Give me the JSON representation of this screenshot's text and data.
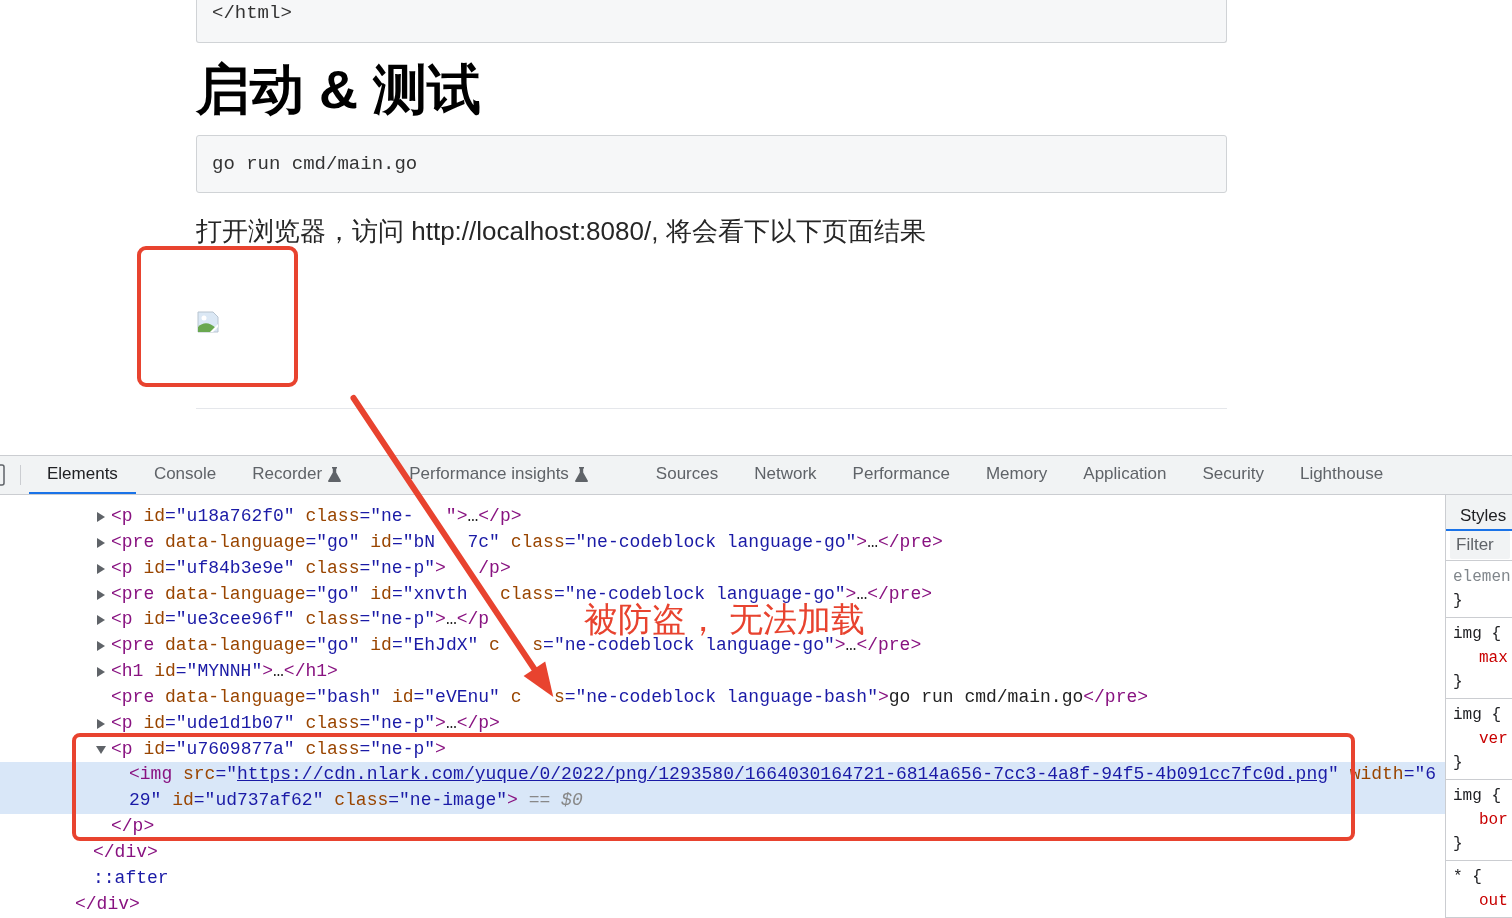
{
  "page": {
    "code_top": "</html>",
    "heading": "启动 & 测试",
    "code_block": "go run cmd/main.go",
    "paragraph": "打开浏览器，访问 http://localhost:8080/, 将会看下以下页面结果"
  },
  "devtools": {
    "tabs": [
      {
        "label": "Elements",
        "selected": true,
        "experimental": false
      },
      {
        "label": "Console",
        "selected": false,
        "experimental": false
      },
      {
        "label": "Recorder",
        "selected": false,
        "experimental": true
      },
      {
        "label": "Performance insights",
        "selected": false,
        "experimental": true
      },
      {
        "label": "Sources",
        "selected": false,
        "experimental": false
      },
      {
        "label": "Network",
        "selected": false,
        "experimental": false
      },
      {
        "label": "Performance",
        "selected": false,
        "experimental": false
      },
      {
        "label": "Memory",
        "selected": false,
        "experimental": false
      },
      {
        "label": "Application",
        "selected": false,
        "experimental": false
      },
      {
        "label": "Security",
        "selected": false,
        "experimental": false
      },
      {
        "label": "Lighthouse",
        "selected": false,
        "experimental": false
      }
    ],
    "tree": [
      {
        "children": [
          {
            "children": [
              {
                "expanded": false,
                "selected": false,
                "segments": [
                  {
                    "kind": "tag",
                    "text": "<p"
                  },
                  {
                    "kind": "attr",
                    "text": " id"
                  },
                  {
                    "kind": "value",
                    "text": "=\"u18a762f0\""
                  },
                  {
                    "kind": "attr",
                    "text": " class"
                  },
                  {
                    "kind": "value",
                    "text": "=\"ne-"
                  },
                  {
                    "kind": "tag",
                    "text": "\">",
                    "hidden_before": true
                  },
                  {
                    "kind": "text",
                    "text": "…"
                  },
                  {
                    "kind": "tag",
                    "text": "</p>"
                  }
                ]
              },
              {
                "expanded": false,
                "selected": false,
                "segments": [
                  {
                    "kind": "tag",
                    "text": "<pre"
                  },
                  {
                    "kind": "attr",
                    "text": " data-language"
                  },
                  {
                    "kind": "value",
                    "text": "=\"go\""
                  },
                  {
                    "kind": "attr",
                    "text": " id"
                  },
                  {
                    "kind": "value",
                    "text": "=\"bN"
                  },
                  {
                    "kind": "value",
                    "text": "7c\"",
                    "hidden_before": true
                  },
                  {
                    "kind": "attr",
                    "text": " class"
                  },
                  {
                    "kind": "value",
                    "text": "=\"ne-codeblock language-go\""
                  },
                  {
                    "kind": "tag",
                    "text": ">"
                  },
                  {
                    "kind": "text",
                    "text": "…"
                  },
                  {
                    "kind": "tag",
                    "text": "</pre>"
                  }
                ]
              },
              {
                "expanded": false,
                "selected": false,
                "segments": [
                  {
                    "kind": "tag",
                    "text": "<p"
                  },
                  {
                    "kind": "attr",
                    "text": " id"
                  },
                  {
                    "kind": "value",
                    "text": "=\"uf84b3e9e\""
                  },
                  {
                    "kind": "attr",
                    "text": " class"
                  },
                  {
                    "kind": "value",
                    "text": "=\"ne-p\""
                  },
                  {
                    "kind": "tag",
                    "text": ">"
                  },
                  {
                    "kind": "tag",
                    "text": "/p>",
                    "hidden_before": true
                  }
                ]
              },
              {
                "expanded": false,
                "selected": false,
                "segments": [
                  {
                    "kind": "tag",
                    "text": "<pre"
                  },
                  {
                    "kind": "attr",
                    "text": " data-language"
                  },
                  {
                    "kind": "value",
                    "text": "=\"go\""
                  },
                  {
                    "kind": "attr",
                    "text": " id"
                  },
                  {
                    "kind": "value",
                    "text": "=\"xnvth"
                  },
                  {
                    "kind": "attr",
                    "text": "class",
                    "hidden_before": true
                  },
                  {
                    "kind": "value",
                    "text": "=\"ne-codeblock language-go\""
                  },
                  {
                    "kind": "tag",
                    "text": ">"
                  },
                  {
                    "kind": "text",
                    "text": "…"
                  },
                  {
                    "kind": "tag",
                    "text": "</pre>"
                  }
                ]
              },
              {
                "expanded": false,
                "selected": false,
                "segments": [
                  {
                    "kind": "tag",
                    "text": "<p"
                  },
                  {
                    "kind": "attr",
                    "text": " id"
                  },
                  {
                    "kind": "value",
                    "text": "=\"ue3cee96f\""
                  },
                  {
                    "kind": "attr",
                    "text": " class"
                  },
                  {
                    "kind": "value",
                    "text": "=\"ne-p\""
                  },
                  {
                    "kind": "tag",
                    "text": ">"
                  },
                  {
                    "kind": "text",
                    "text": "…"
                  },
                  {
                    "kind": "tag",
                    "text": "</p"
                  }
                ]
              },
              {
                "expanded": false,
                "selected": false,
                "segments": [
                  {
                    "kind": "tag",
                    "text": "<pre"
                  },
                  {
                    "kind": "attr",
                    "text": " data-language"
                  },
                  {
                    "kind": "value",
                    "text": "=\"go\""
                  },
                  {
                    "kind": "attr",
                    "text": " id"
                  },
                  {
                    "kind": "value",
                    "text": "=\"EhJdX\""
                  },
                  {
                    "kind": "attr",
                    "text": " c"
                  },
                  {
                    "kind": "attr",
                    "text": "s",
                    "hidden_before": true
                  },
                  {
                    "kind": "value",
                    "text": "=\"ne-codeblock language-go\""
                  },
                  {
                    "kind": "tag",
                    "text": ">"
                  },
                  {
                    "kind": "text",
                    "text": "…"
                  },
                  {
                    "kind": "tag",
                    "text": "</pre>"
                  }
                ]
              },
              {
                "expanded": false,
                "selected": false,
                "segments": [
                  {
                    "kind": "tag",
                    "text": "<h1"
                  },
                  {
                    "kind": "attr",
                    "text": " id"
                  },
                  {
                    "kind": "value",
                    "text": "=\"MYNNH\""
                  },
                  {
                    "kind": "tag",
                    "text": ">"
                  },
                  {
                    "kind": "text",
                    "text": "…"
                  },
                  {
                    "kind": "tag",
                    "text": "</h1>"
                  }
                ]
              },
              {
                "selected": false,
                "segments": [
                  {
                    "kind": "tag",
                    "text": "<pre"
                  },
                  {
                    "kind": "attr",
                    "text": " data-language"
                  },
                  {
                    "kind": "value",
                    "text": "=\"bash\""
                  },
                  {
                    "kind": "attr",
                    "text": " id"
                  },
                  {
                    "kind": "value",
                    "text": "=\"eVEnu\""
                  },
                  {
                    "kind": "attr",
                    "text": " c"
                  },
                  {
                    "kind": "attr",
                    "text": "s",
                    "hidden_before": true
                  },
                  {
                    "kind": "value",
                    "text": "=\"ne-codeblock language-bash\""
                  },
                  {
                    "kind": "tag",
                    "text": ">"
                  },
                  {
                    "kind": "text",
                    "text": "go run cmd/main.go"
                  },
                  {
                    "kind": "tag",
                    "text": "</pre>"
                  }
                ]
              },
              {
                "expanded": false,
                "selected": false,
                "segments": [
                  {
                    "kind": "tag",
                    "text": "<p"
                  },
                  {
                    "kind": "attr",
                    "text": " id"
                  },
                  {
                    "kind": "value",
                    "text": "=\"ude1d1b07\""
                  },
                  {
                    "kind": "attr",
                    "text": " class"
                  },
                  {
                    "kind": "value",
                    "text": "=\"ne-p\""
                  },
                  {
                    "kind": "tag",
                    "text": ">"
                  },
                  {
                    "kind": "text",
                    "text": "…"
                  },
                  {
                    "kind": "tag",
                    "text": "</p>"
                  }
                ]
              },
              {
                "expanded": true,
                "selected": false,
                "segments": [
                  {
                    "kind": "tag",
                    "text": "<p"
                  },
                  {
                    "kind": "attr",
                    "text": " id"
                  },
                  {
                    "kind": "value",
                    "text": "=\"u7609877a\""
                  },
                  {
                    "kind": "attr",
                    "text": " class"
                  },
                  {
                    "kind": "value",
                    "text": "=\"ne-p\""
                  },
                  {
                    "kind": "tag",
                    "text": ">"
                  }
                ],
                "children": [
                  {
                    "selected": true,
                    "segments": [
                      {
                        "kind": "tag",
                        "text": "<img"
                      },
                      {
                        "kind": "attr",
                        "text": " src"
                      },
                      {
                        "kind": "value",
                        "text": "=\""
                      },
                      {
                        "kind": "link",
                        "text": "https://cdn.nlark.com/yuque/0/2022/png/1293580/1664030164721-6814a656-7cc3-4a8f-94f5-4b091cc7fc0d.png"
                      },
                      {
                        "kind": "value",
                        "text": "\""
                      },
                      {
                        "kind": "attr",
                        "text": " width"
                      },
                      {
                        "kind": "value",
                        "text": "=\"629\""
                      },
                      {
                        "kind": "attr",
                        "text": " id"
                      },
                      {
                        "kind": "value",
                        "text": "=\"ud737af62\""
                      },
                      {
                        "kind": "attr",
                        "text": " class"
                      },
                      {
                        "kind": "value",
                        "text": "=\"ne-image\""
                      },
                      {
                        "kind": "tag",
                        "text": ">"
                      },
                      {
                        "kind": "hint",
                        "text": " == "
                      },
                      {
                        "kind": "var",
                        "text": "$0"
                      }
                    ]
                  }
                ],
                "closing": [
                  {
                    "kind": "tag",
                    "text": "</p>"
                  }
                ]
              }
            ],
            "closing": [
              {
                "kind": "tag",
                "text": "</div>"
              }
            ]
          },
          {
            "selected": false,
            "segments": [
              {
                "kind": "pseudo",
                "text": "::after"
              }
            ]
          }
        ],
        "closing": [
          {
            "kind": "tag",
            "text": "</div>"
          }
        ]
      }
    ],
    "styles": {
      "tab": "Styles",
      "filter_placeholder": "Filter",
      "rules": [
        {
          "selector": "elemen",
          "muted": true,
          "close": "}"
        },
        {
          "selector": "img {",
          "muted": false,
          "declarations": [
            "max"
          ],
          "close": "}"
        },
        {
          "selector": "img {",
          "muted": false,
          "declarations": [
            "ver"
          ],
          "close": "}"
        },
        {
          "selector": "img {",
          "muted": false,
          "declarations": [
            "bor"
          ],
          "close": "}"
        },
        {
          "selector": "* {",
          "muted": false,
          "declarations": [
            "out"
          ]
        }
      ]
    }
  },
  "annotation": {
    "label": "被防盗， 无法加载"
  }
}
